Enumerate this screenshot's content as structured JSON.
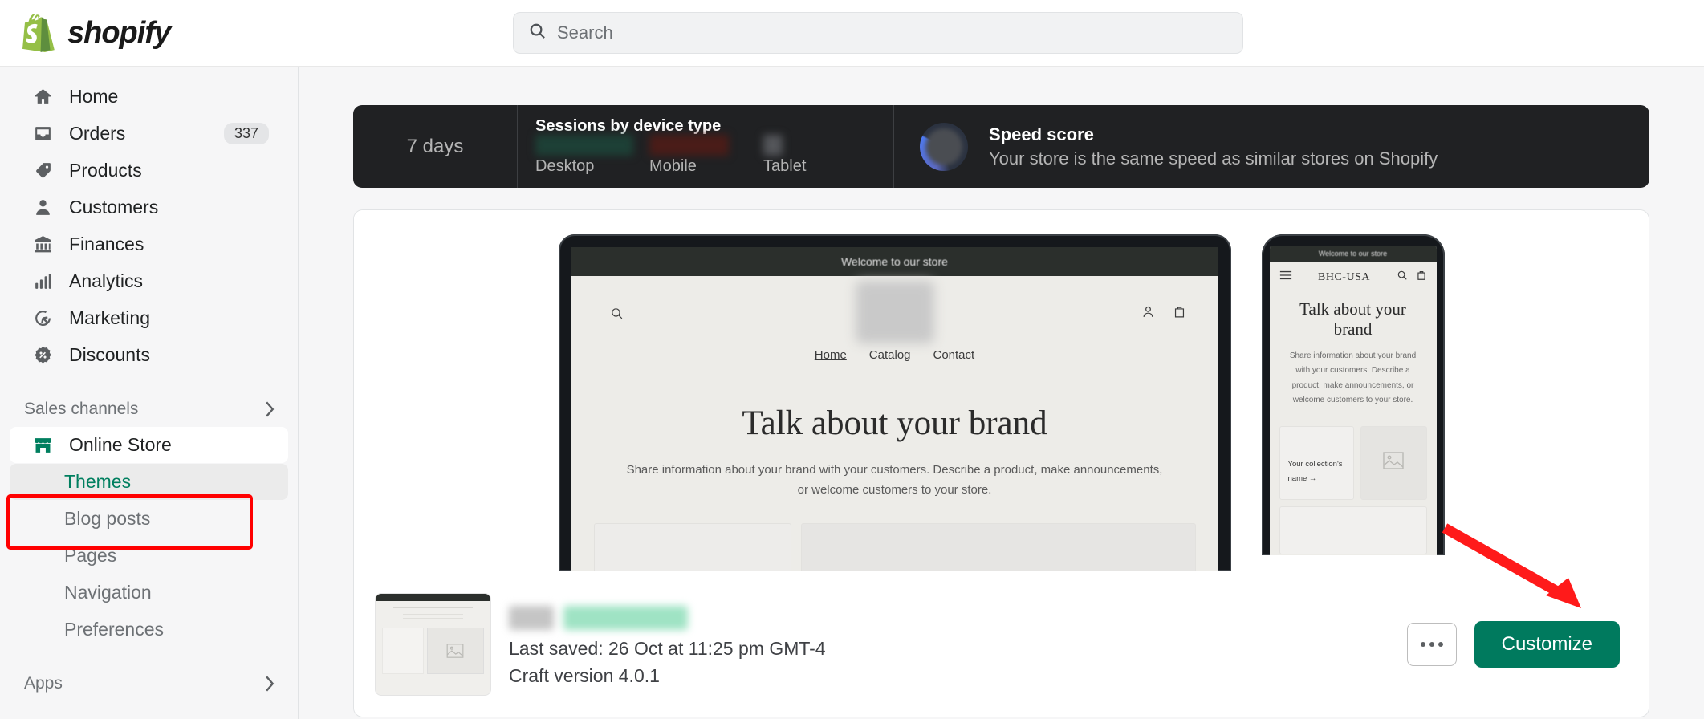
{
  "brand": {
    "name": "shopify",
    "logo_icon": "shopify-bag-logo"
  },
  "search": {
    "placeholder": "Search",
    "icon": "search-icon"
  },
  "sidebar": {
    "items": [
      {
        "label": "Home",
        "icon": "home-icon",
        "badge": ""
      },
      {
        "label": "Orders",
        "icon": "orders-inbox-icon",
        "badge": "337"
      },
      {
        "label": "Products",
        "icon": "products-tag-icon",
        "badge": ""
      },
      {
        "label": "Customers",
        "icon": "customers-person-icon",
        "badge": ""
      },
      {
        "label": "Finances",
        "icon": "finances-bank-icon",
        "badge": ""
      },
      {
        "label": "Analytics",
        "icon": "analytics-bars-icon",
        "badge": ""
      },
      {
        "label": "Marketing",
        "icon": "marketing-target-icon",
        "badge": ""
      },
      {
        "label": "Discounts",
        "icon": "discounts-percent-icon",
        "badge": ""
      }
    ],
    "sales_channels": {
      "label": "Sales channels",
      "chevron_icon": "chevron-right-icon"
    },
    "online_store": {
      "label": "Online Store",
      "icon": "storefront-icon"
    },
    "online_store_children": [
      {
        "label": "Themes",
        "active": true
      },
      {
        "label": "Blog posts",
        "active": false
      },
      {
        "label": "Pages",
        "active": false
      },
      {
        "label": "Navigation",
        "active": false
      },
      {
        "label": "Preferences",
        "active": false
      }
    ],
    "apps": {
      "label": "Apps",
      "chevron_icon": "chevron-right-icon"
    }
  },
  "stats": {
    "range_label": "7 days",
    "sessions": {
      "title": "Sessions by device type",
      "devices": [
        {
          "label": "Desktop",
          "bar_color": "#1d4036",
          "bar_width_pct": 86,
          "value_hidden": true
        },
        {
          "label": "Mobile",
          "bar_color": "#4a1c18",
          "bar_width_pct": 70,
          "value_hidden": true
        },
        {
          "label": "Tablet",
          "bar_color": "#54565a",
          "bar_width_pct": 17,
          "value_hidden": true
        }
      ]
    },
    "speed": {
      "title": "Speed score",
      "description": "Your store is the same speed as similar stores on Shopify",
      "donut_icon": "speed-donut-chart",
      "accent": "#4f7cf7"
    }
  },
  "preview": {
    "desktop": {
      "announcement": "Welcome to our store",
      "logo_icon": "store-logo-placeholder",
      "search_icon": "search-icon",
      "account_icon": "account-person-icon",
      "cart_icon": "shopping-bag-icon",
      "nav": [
        {
          "label": "Home",
          "current": true
        },
        {
          "label": "Catalog",
          "current": false
        },
        {
          "label": "Contact",
          "current": false
        }
      ],
      "heading": "Talk about your brand",
      "paragraph_line1": "Share information about your brand with your customers. Describe a product, make announcements,",
      "paragraph_line2": "or welcome customers to your store."
    },
    "mobile": {
      "announcement": "Welcome to our store",
      "menu_icon": "hamburger-menu-icon",
      "brand": "BHC-USA",
      "search_icon": "search-icon",
      "cart_icon": "shopping-bag-icon",
      "heading": "Talk about your brand",
      "paragraph": "Share information about your brand with your customers. Describe a product, make announcements, or welcome customers to your store.",
      "collection_label": "Your collection's name  →",
      "image_placeholder_icon": "image-placeholder-icon"
    }
  },
  "theme_footer": {
    "thumbnail_icon": "theme-thumbnail-preview",
    "theme_name_redacted": true,
    "last_saved": "Last saved: 26 Oct at 11:25 pm GMT-4",
    "version": "Craft version 4.0.1",
    "more_button_label": "•••",
    "more_button_icon": "ellipsis-horizontal-icon",
    "customize_label": "Customize",
    "customize_color": "#007a5e"
  },
  "annotations": {
    "highlight_box_color": "#ff0000",
    "arrow_color": "#ff1a1a",
    "arrow_target": "customize-button",
    "highlight_target": "online-store-and-themes"
  }
}
